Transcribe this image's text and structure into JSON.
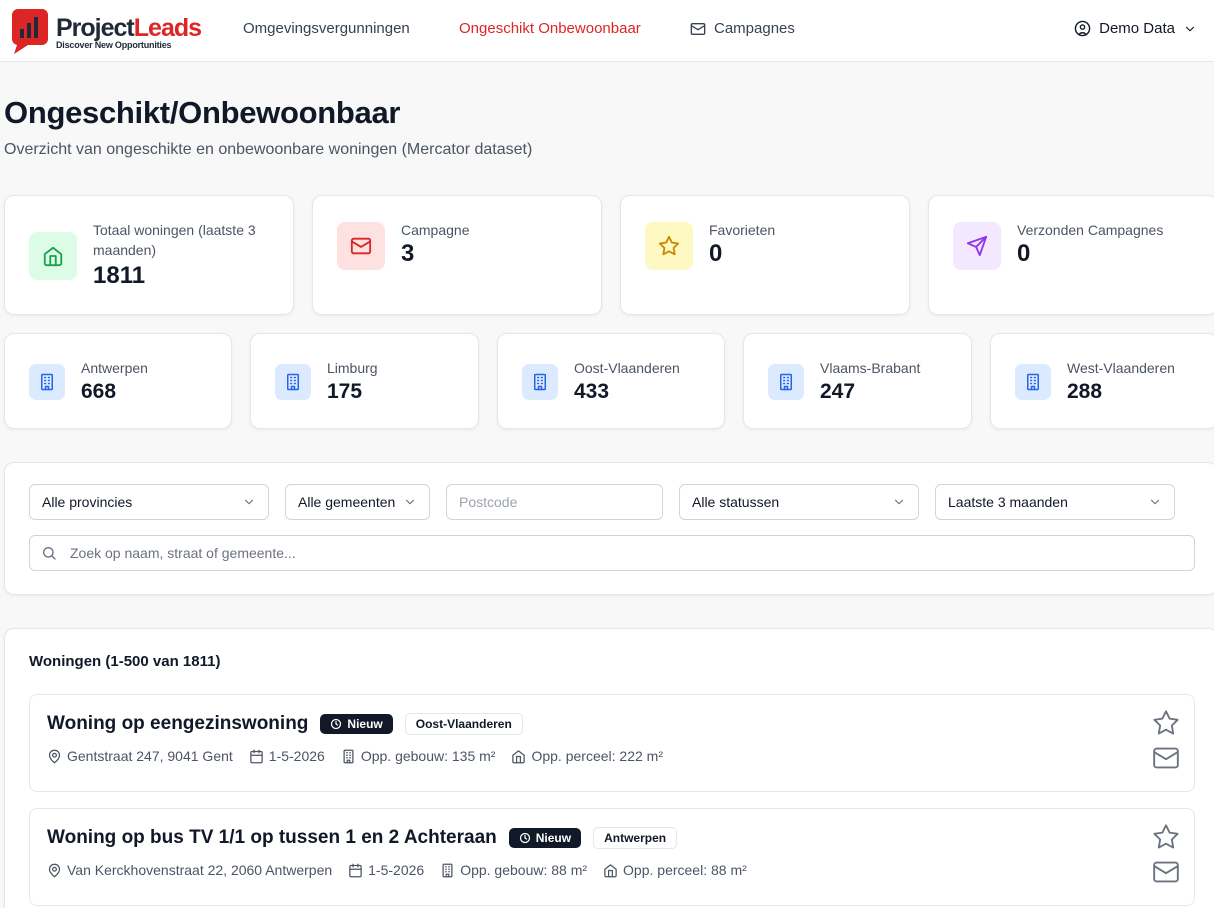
{
  "brand": {
    "name_part1": "Project",
    "name_part2": "Leads",
    "tagline": "Discover New Opportunities"
  },
  "nav": {
    "items": [
      {
        "label": "Omgevingsvergunningen"
      },
      {
        "label": "Ongeschikt Onbewoonbaar"
      },
      {
        "label": "Campagnes"
      }
    ],
    "active": "Ongeschikt Onbewoonbaar",
    "user": "Demo Data"
  },
  "page": {
    "title": "Ongeschikt/Onbewoonbaar",
    "subtitle": "Overzicht van ongeschikte en onbewoonbare woningen (Mercator dataset)"
  },
  "stats": [
    {
      "label": "Totaal woningen (laatste 3 maanden)",
      "value": "1811",
      "icon": "home-icon",
      "color": "#16a34a",
      "bg": "#dcfce7"
    },
    {
      "label": "Campagne",
      "value": "3",
      "icon": "mail-icon",
      "color": "#dc2626",
      "bg": "#fee2e2"
    },
    {
      "label": "Favorieten",
      "value": "0",
      "icon": "star-icon",
      "color": "#ca8a04",
      "bg": "#fef9c3"
    },
    {
      "label": "Verzonden Campagnes",
      "value": "0",
      "icon": "send-icon",
      "color": "#9333ea",
      "bg": "#f3e8ff"
    }
  ],
  "provinces": [
    {
      "label": "Antwerpen",
      "value": "668"
    },
    {
      "label": "Limburg",
      "value": "175"
    },
    {
      "label": "Oost-Vlaanderen",
      "value": "433"
    },
    {
      "label": "Vlaams-Brabant",
      "value": "247"
    },
    {
      "label": "West-Vlaanderen",
      "value": "288"
    }
  ],
  "filters": {
    "province": "Alle provincies",
    "municipality": "Alle gemeenten",
    "postcode_placeholder": "Postcode",
    "status": "Alle statussen",
    "period": "Laatste 3 maanden",
    "search_placeholder": "Zoek op naam, straat of gemeente..."
  },
  "list": {
    "title": "Woningen (1-500 van 1811)",
    "items": [
      {
        "title": "Woning op eengezinswoning",
        "badge": "Nieuw",
        "province": "Oost-Vlaanderen",
        "address": "Gentstraat 247, 9041 Gent",
        "date": "1-5-2026",
        "building_area": "Opp. gebouw: 135 m²",
        "plot_area": "Opp. perceel: 222 m²"
      },
      {
        "title": "Woning op bus TV 1/1 op tussen 1 en 2 Achteraan",
        "badge": "Nieuw",
        "province": "Antwerpen",
        "address": "Van Kerckhovenstraat 22, 2060 Antwerpen",
        "date": "1-5-2026",
        "building_area": "Opp. gebouw: 88 m²",
        "plot_area": "Opp. perceel: 88 m²"
      }
    ]
  }
}
